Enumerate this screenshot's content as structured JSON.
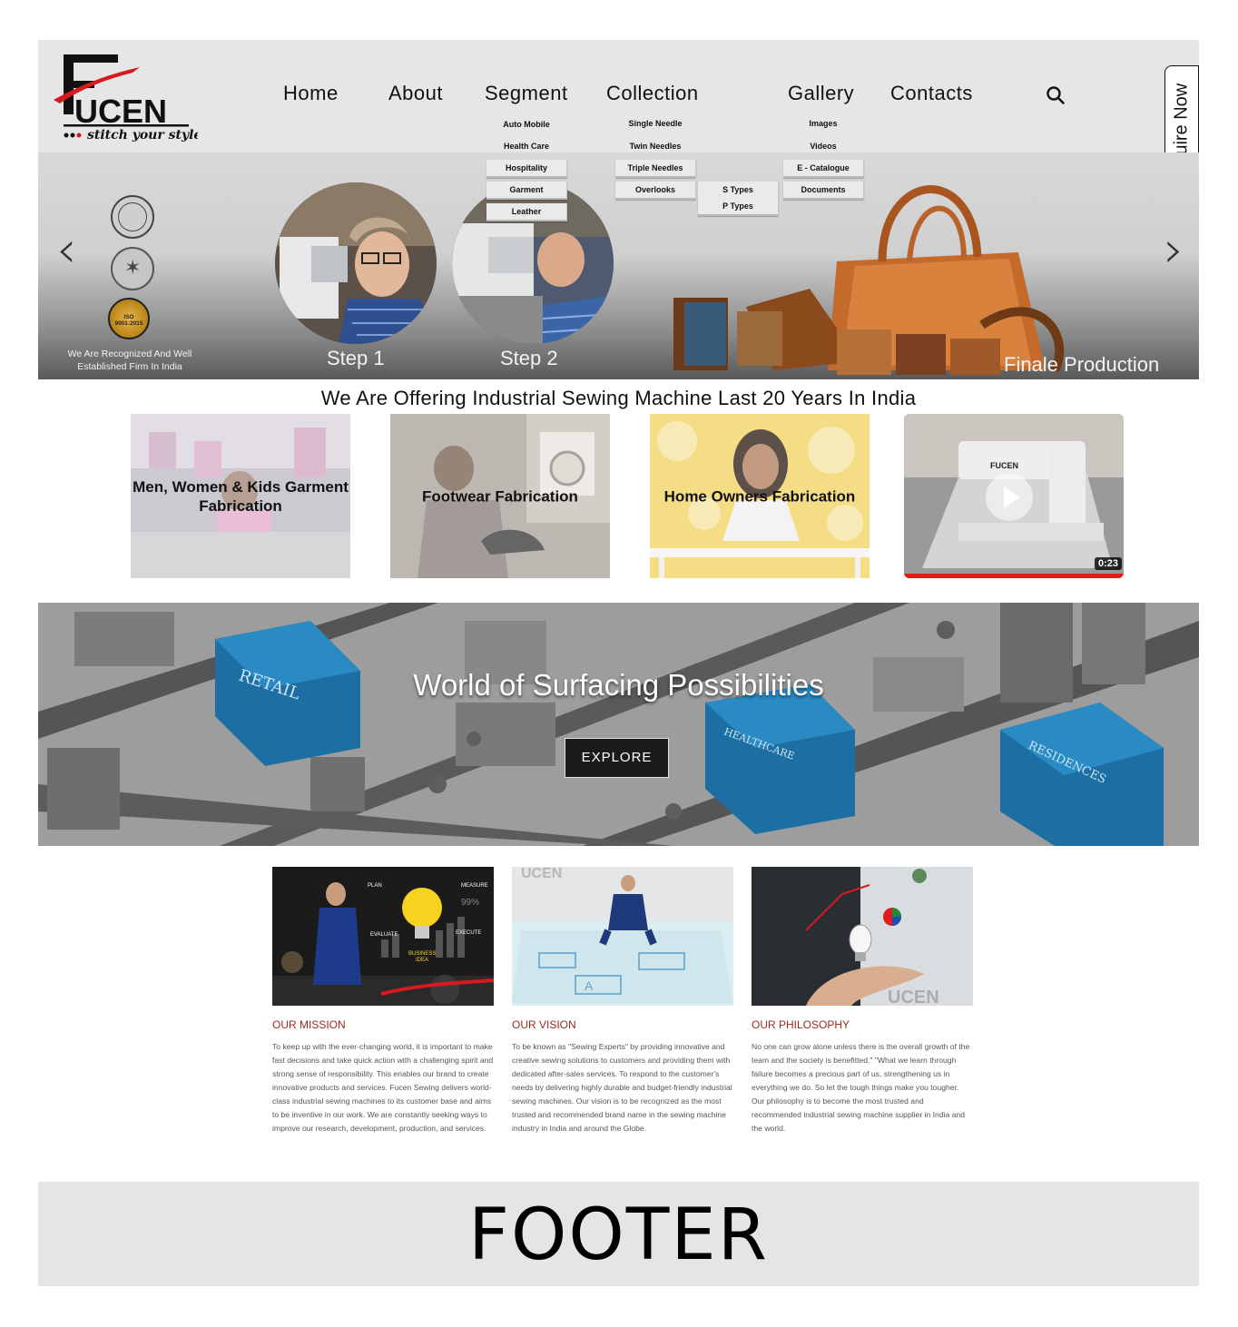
{
  "brand": {
    "name": "UCEN",
    "tagline": "stitch your style",
    "accent_color": "#d71920"
  },
  "nav": {
    "home": "Home",
    "about": "About",
    "segment": "Segment",
    "collection": "Collection",
    "gallery": "Gallery",
    "contacts": "Contacts",
    "search_icon": "search-icon"
  },
  "dropdowns": {
    "segment": [
      "Auto Mobile",
      "Health Care",
      "Hospitality",
      "Garment",
      "Leather"
    ],
    "collection": [
      "Single Needle",
      "Twin Needles",
      "Triple Needles",
      "Overlooks"
    ],
    "overlooks_sub": [
      "S Types",
      "P Types"
    ],
    "gallery": [
      "Images",
      "Videos",
      "E - Catalogue",
      "Documents"
    ]
  },
  "enquire": "Enquire Now",
  "hero": {
    "recognized": "We Are Recognized And Well Established Firm In India",
    "iso_badge": "ISO 9001:2015",
    "step1": "Step 1",
    "step2": "Step 2",
    "finale": "Finale Production",
    "prev_icon": "chevron-left-icon",
    "next_icon": "chevron-right-icon"
  },
  "offer": {
    "heading": "We Are Offering Industrial Sewing Machine Last 20 Years In India",
    "cards": [
      "Men, Women & Kids Garment Fabrication",
      "Footwear Fabrication",
      "Home Owners Fabrication"
    ],
    "video_duration": "0:23",
    "video_accent": "#e21b1b"
  },
  "world": {
    "title": "World of Surfacing Possibilities",
    "button": "EXPLORE",
    "signs": [
      "RETAIL",
      "HEALTHCARE",
      "RESIDENCES"
    ]
  },
  "mission": {
    "title_color": "#9a2a1f",
    "items": [
      {
        "title": "OUR MISSION",
        "text": "To keep up with the ever-changing world, it is important to make fast decisions and take quick action with a challenging spirit and strong sense of responsibility. This enables our brand to create innovative products and services. Fucen Sewing delivers world-class industrial sewing machines to its customer base and aims to be inventive in our work. We are constantly seeking ways to improve our research, development, production, and services.",
        "image_words": [
          "PLAN",
          "MEASURE",
          "99%",
          "EVALUATE",
          "EXECUTE",
          "BUSINESS",
          "IDEA"
        ]
      },
      {
        "title": "OUR VISION",
        "text": "To be known as \"Sewing Experts\" by providing innovative and creative sewing solutions to customers and providing them with dedicated after-sales services. To respond to the customer's needs by delivering highly durable and budget-friendly industrial sewing machines. Our vision is to be recognized as the most trusted and recommended brand name in the sewing machine industry in India and around the Globe."
      },
      {
        "title": "OUR PHILOSOPHY",
        "text": "No one can grow alone unless there is the overall growth of the team and the society is benefitted.\" \"What we learn through failure becomes a precious part of us, strengthening us in everything we do. So let the tough things make you tougher. Our philosophy is to become the most trusted and recommended industrial sewing machine supplier in India and the world."
      }
    ]
  },
  "footer": {
    "label": "FOOTER"
  }
}
